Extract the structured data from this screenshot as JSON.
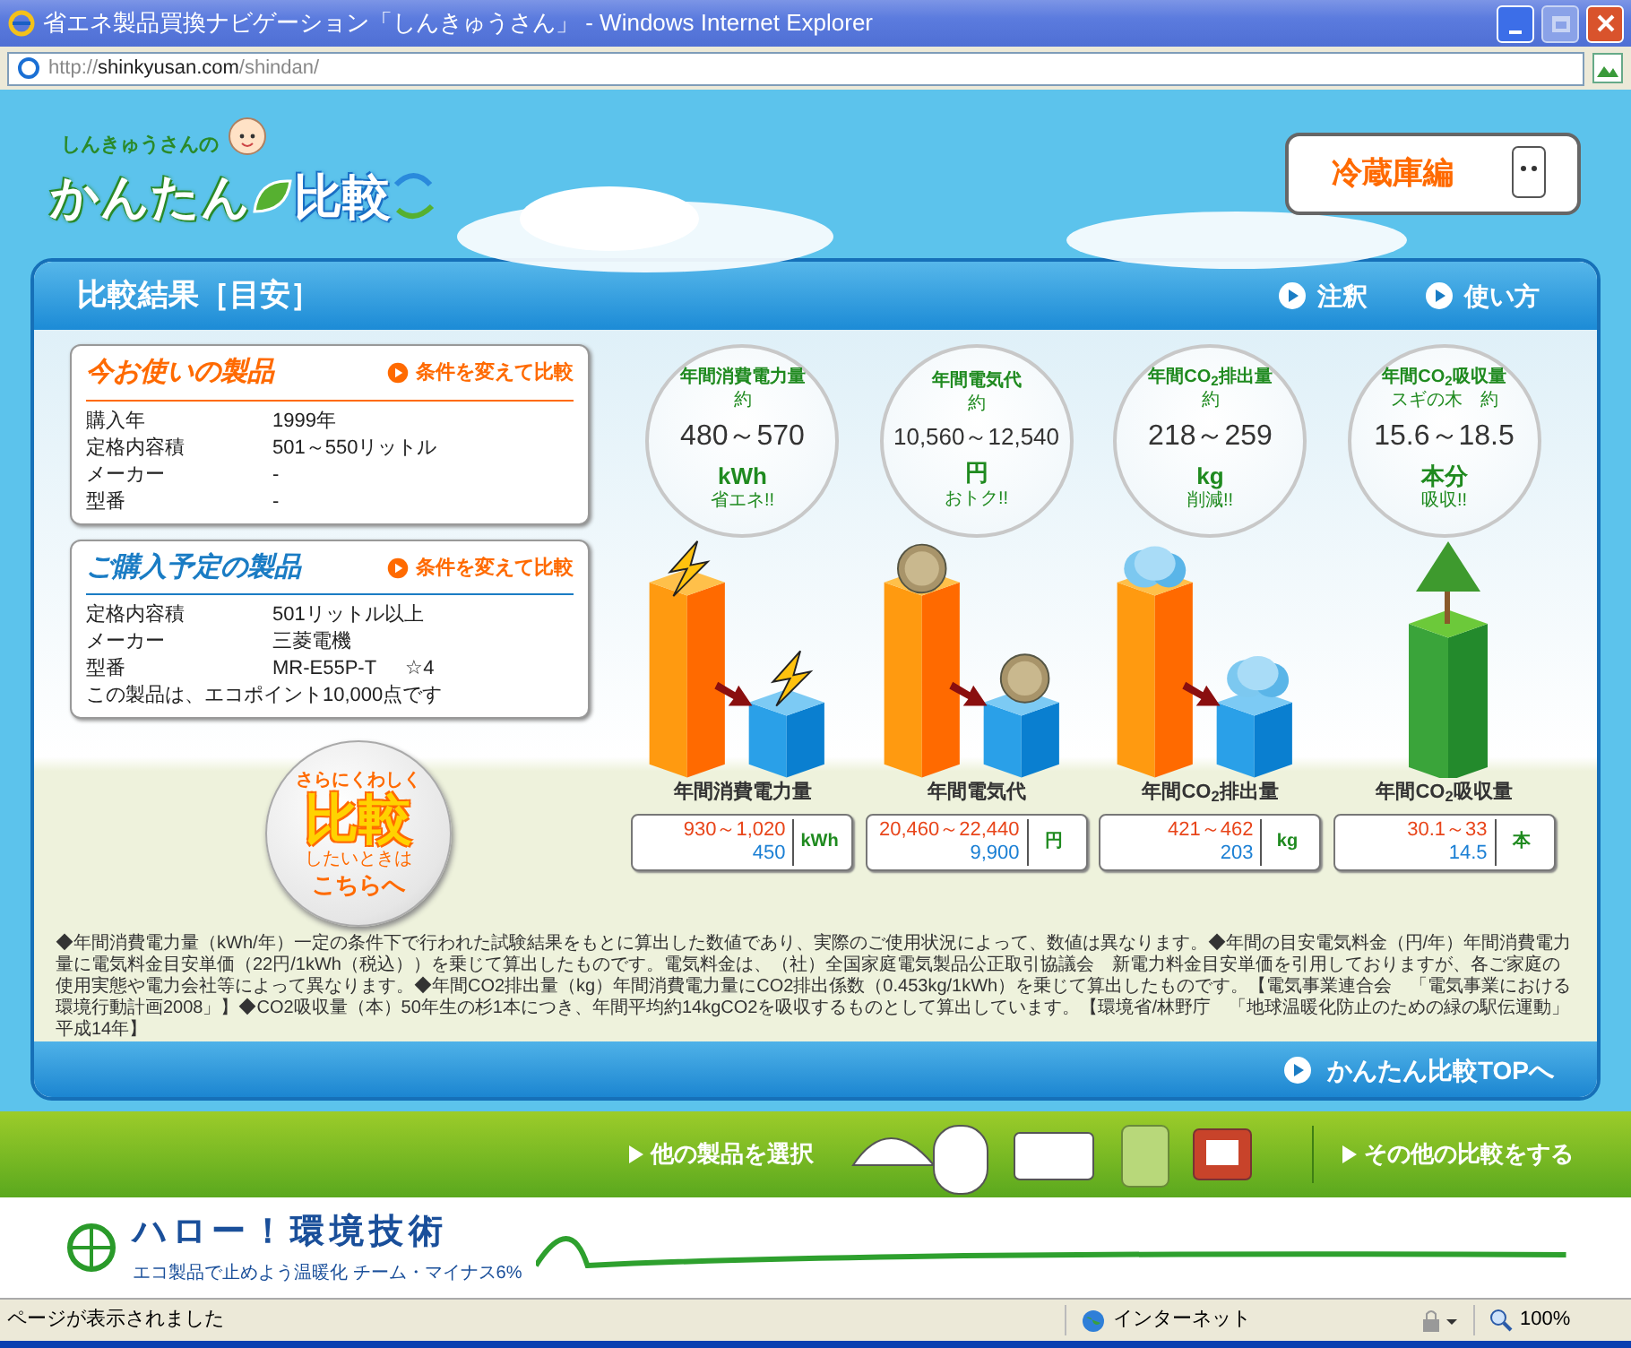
{
  "window": {
    "title": "省エネ製品買換ナビゲーション「しんきゅうさん」 - Windows Internet Explorer",
    "address": [
      {
        "kind": "dim",
        "text": "http://"
      },
      {
        "kind": "strong",
        "text": "shinkyusan.com"
      },
      {
        "kind": "dim",
        "text": "/shindan/"
      }
    ]
  },
  "header": {
    "logo_caption": "しんきゅうさんの",
    "logo_main": "かんたん",
    "logo_accent": "比較",
    "category_button": "冷蔵庫編"
  },
  "panel": {
    "title": "比較結果［目安］",
    "links": [
      "注釈",
      "使い方"
    ],
    "products": [
      {
        "kind": "current",
        "heading": "今お使いの製品",
        "action": "条件を変えて比較",
        "specs": [
          {
            "label": "購入年",
            "value": "1999年"
          },
          {
            "label": "定格内容積",
            "value": "501～550リットル"
          },
          {
            "label": "メーカー",
            "value": "-"
          },
          {
            "label": "型番",
            "value": "-"
          }
        ]
      },
      {
        "kind": "planned",
        "heading": "ご購入予定の製品",
        "action": "条件を変えて比較",
        "specs": [
          {
            "label": "定格内容積",
            "value": "501リットル以上"
          },
          {
            "label": "メーカー",
            "value": "三菱電機"
          },
          {
            "label": "型番",
            "value": "MR-E55P-T",
            "rating": "☆4"
          }
        ],
        "note": "この製品は、エコポイント10,000点です"
      }
    ],
    "detail_button": {
      "line_1": "さらにくわしく",
      "big": "比較",
      "small": "したいときは",
      "line_2": "こちらへ"
    },
    "metrics": [
      {
        "kind": "electricity",
        "title": "年間消費電力量",
        "sub": "約",
        "value": "480～570",
        "unit": "kWh",
        "tagline": "省エネ!!",
        "bar_label": "年間消費電力量",
        "before": "930～1,020",
        "after": "450",
        "unit_short": "kWh"
      },
      {
        "kind": "money",
        "title": "年間電気代",
        "sub": "約",
        "value": "10,560～12,540",
        "unit": "円",
        "tagline": "おトク!!",
        "bar_label": "年間電気代",
        "before": "20,460～22,440",
        "after": "9,900",
        "unit_short": "円"
      },
      {
        "kind": "co2",
        "title": "年間CO$_{2}$排出量",
        "sub": "約",
        "value": "218～259",
        "unit": "kg",
        "tagline": "削減!!",
        "bar_label": "年間CO$_{2}$排出量",
        "before": "421～462",
        "after": "203",
        "unit_short": "kg"
      },
      {
        "kind": "tree",
        "title": "年間CO$_{2}$吸収量",
        "sub": "スギの木　約",
        "value": "15.6～18.5",
        "unit": "本分",
        "tagline": "吸収!!",
        "bar_label": "年間CO$_{2}$吸収量",
        "before": "30.1～33",
        "after": "14.5",
        "unit_short": "本"
      }
    ],
    "footnote": "◆年間消費電力量（kWh/年）一定の条件下で行われた試験結果をもとに算出した数値であり、実際のご使用状況によって、数値は異なります。◆年間の目安電気料金（円/年）年間消費電力量に電気料金目安単価（22円/1kWh（税込））を乗じて算出したものです。電気料金は、（社）全国家庭電気製品公正取引協議会　新電力料金目安単価を引用しておりますが、各ご家庭の使用実態や電力会社等によって異なります。◆年間CO2排出量（kg）年間消費電力量にCO2排出係数（0.453kg/1kWh）を乗じて算出したものです。【電気事業連合会　「電気事業における環境行動計画2008」】◆CO2吸収量（本）50年生の杉1本につき、年間平均約14kgCO2を吸収するものとして算出しています。【環境省/林野庁　「地球温暖化防止のための緑の駅伝運動」平成14年】",
    "top_link": "かんたん比較TOPへ"
  },
  "nav_band": {
    "links": [
      "他の製品を選択",
      "その他の比較をする"
    ]
  },
  "footer": {
    "logo": "ハロー！環境技術",
    "tagline": "エコ製品で止めよう温暖化 チーム・マイナス6%"
  },
  "status_bar": {
    "message": "ページが表示されました",
    "zone": "インターネット",
    "zoom": "100%"
  }
}
